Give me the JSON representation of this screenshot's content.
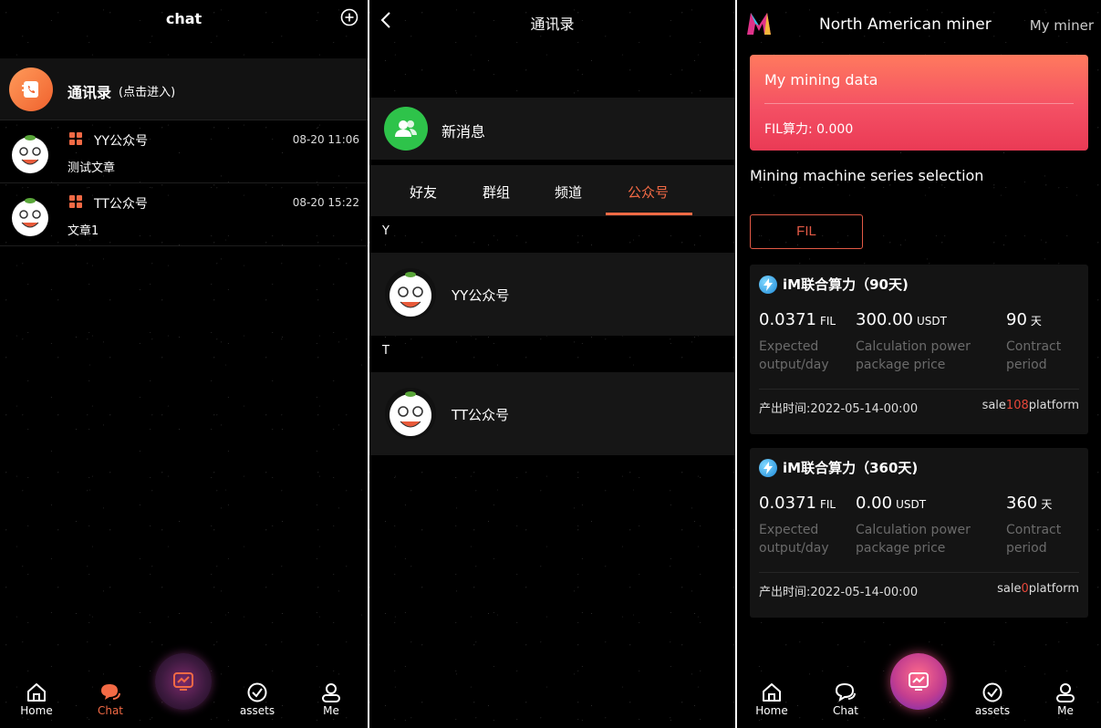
{
  "chat_screen": {
    "title": "chat",
    "contacts_entry": {
      "label": "通讯录",
      "hint": "(点击进入)"
    },
    "messages": [
      {
        "name": "YY公众号",
        "time": "08-20 11:06",
        "preview": "测试文章"
      },
      {
        "name": "TT公众号",
        "time": "08-20 15:22",
        "preview": "文章1"
      }
    ],
    "nav": {
      "home": "Home",
      "chat": "Chat",
      "assets": "assets",
      "me": "Me"
    }
  },
  "contacts_screen": {
    "title": "通讯录",
    "new_messages": "新消息",
    "tabs": [
      "好友",
      "群组",
      "频道",
      "公众号"
    ],
    "active_tab": "公众号",
    "groups": [
      {
        "letter": "Y",
        "name": "YY公众号"
      },
      {
        "letter": "T",
        "name": "TT公众号"
      }
    ]
  },
  "miner_screen": {
    "title": "North American miner",
    "right_link": "My miner",
    "mining_card": {
      "title": "My mining data",
      "value": "FIL算力: 0.000"
    },
    "series_title": "Mining machine series selection",
    "filter_button": "FIL",
    "products": [
      {
        "name": "iM联合算力（90天)",
        "output": "0.0371",
        "output_unit": "FIL",
        "price": "300.00",
        "price_unit": "USDT",
        "period": "90",
        "period_unit": "天",
        "output_label": [
          "Expected",
          "output/day"
        ],
        "price_label": [
          "Calculation power",
          "package price"
        ],
        "period_label": [
          "Contract",
          "period"
        ],
        "date": "产出时间:2022-05-14-00:00",
        "sale_prefix": "sale",
        "sale_count": "108",
        "sale_suffix": "platform"
      },
      {
        "name": "iM联合算力（360天)",
        "output": "0.0371",
        "output_unit": "FIL",
        "price": "0.00",
        "price_unit": "USDT",
        "period": "360",
        "period_unit": "天",
        "output_label": [
          "Expected",
          "output/day"
        ],
        "price_label": [
          "Calculation power",
          "package price"
        ],
        "period_label": [
          "Contract",
          "period"
        ],
        "date": "产出时间:2022-05-14-00:00",
        "sale_prefix": "sale",
        "sale_count": "0",
        "sale_suffix": "platform"
      }
    ],
    "nav": {
      "home": "Home",
      "chat": "Chat",
      "assets": "assets",
      "me": "Me"
    }
  },
  "colors": {
    "accent": "#f36a45",
    "card_gradient_top": "#ff7a5e",
    "card_gradient_bottom": "#ea3a55",
    "new_msg_green": "#2ec34a"
  }
}
